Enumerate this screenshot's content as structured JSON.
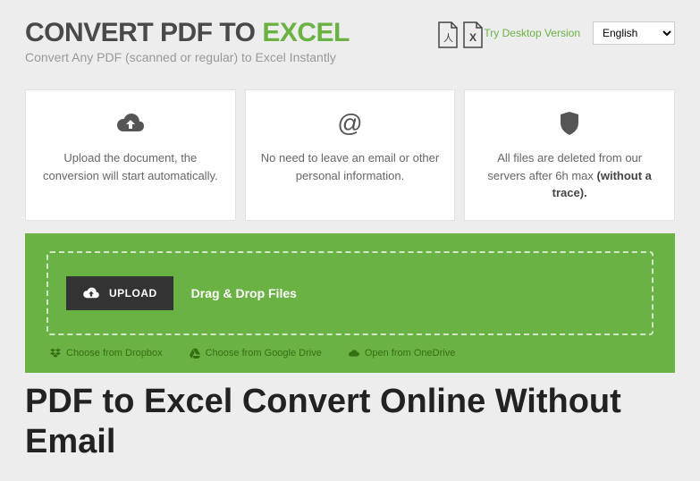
{
  "header": {
    "title_part1": "CONVERT PDF TO ",
    "title_part2": "EXCEL",
    "subtitle": "Convert Any PDF (scanned or regular) to Excel Instantly",
    "desktop_link": "Try Desktop Version",
    "language": "English"
  },
  "features": [
    {
      "text": "Upload the document, the conversion will start automatically.",
      "bold": ""
    },
    {
      "text": "No need to leave an email or other personal information.",
      "bold": ""
    },
    {
      "text": "All files are deleted from our servers after 6h max ",
      "bold": "(without a trace)."
    }
  ],
  "upload": {
    "button": "UPLOAD",
    "drop_text": "Drag & Drop Files",
    "dropbox": "Choose from Dropbox",
    "gdrive": "Choose from Google Drive",
    "onedrive": "Open from OneDrive"
  },
  "article_title": "PDF to Excel Convert Online Without Email"
}
